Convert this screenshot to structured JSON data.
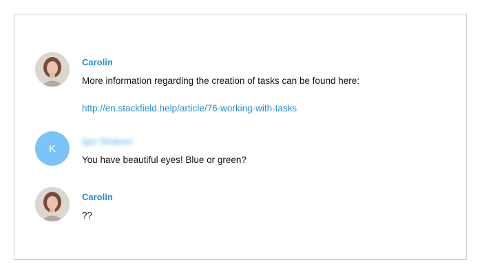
{
  "messages": [
    {
      "author": "Carolin",
      "avatar": "photo-avatar",
      "text": "More information regarding the creation of tasks can be found here:",
      "link": "http://en.stackfield.help/article/76-working-with-tasks"
    },
    {
      "author": "Igor Stratsev",
      "avatar_letter": "K",
      "text": "You have beautiful eyes! Blue or green?"
    },
    {
      "author": "Carolin",
      "avatar": "photo-avatar",
      "text": "??"
    }
  ],
  "colors": {
    "author": "#1f8fd0",
    "link": "#1f8fd0",
    "avatar_letter_bg": "#7cc4f7",
    "border": "#cfcfcf"
  }
}
